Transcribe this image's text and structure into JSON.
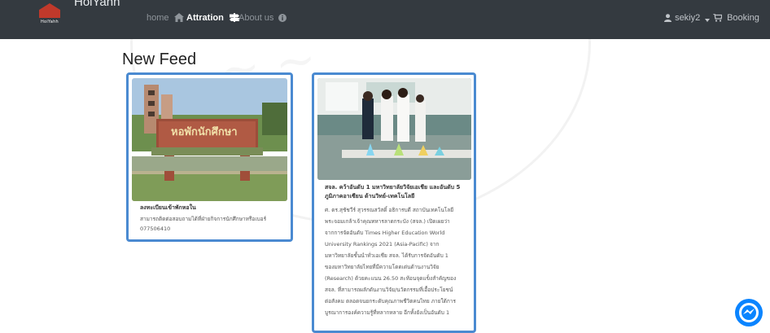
{
  "navbar": {
    "brand_title": "HoiYahh",
    "brand_sub": "HoiYahh",
    "home": "home",
    "attraction": "Attration",
    "about": "About us",
    "user": "sekiy2",
    "booking": "Booking"
  },
  "page": {
    "heading": "New Feed"
  },
  "posts": [
    {
      "title": "ลงทะเบียนเข้าพักหอใน",
      "body": [
        "สามารถติดต่อสอบถามได้ที่ฝ่ายกิจการนักศึกษาหรือเบอร์",
        "077506410"
      ],
      "image_caption": "หอพักนักศึกษา"
    },
    {
      "title": [
        "สจล. คว้าอันดับ 1 มหาวิทยาลัยวิจัยเอเชีย และอันดับ 5",
        "ภูมิภาคอาเซียน ด้านวิทย์-เทคโนโลยี"
      ],
      "body": [
        "ศ. ดร.สุชัชวีร์ สุวรรณสวัสดิ์ อธิการบดี สถาบันเทคโนโลยี",
        "พระจอมเกล้าเจ้าคุณทหารลาดกระบัง (สจล.) เปิดเผยว่า",
        "จากการจัดอันดับ Times Higher Education World",
        "University Rankings 2021 (Asia-Pacific) จาก",
        "มหาวิทยาลัยชั้นนำทั่วเอเชีย สจล. ได้รับการจัดอันดับ 1",
        "ของมหาวิทยาลัยไทยที่มีความโดดเด่นด้านงานวิจัย",
        "(Research) ด้วยคะแนน 26.50 สะท้อนจุดแข็งสำคัญของ",
        "สจล. ที่สามารถผลักดันงานวิจัย/นวัตกรรมที่เอื้อประโยชน์",
        "ต่อสังคม ตลอดจนยกระดับคุณภาพชีวิตคนไทย ภายใต้การ",
        "บูรณาการองค์ความรู้ที่หลากหลาย อีกทั้งยังเป็นอันดับ 1"
      ]
    }
  ],
  "colors": {
    "navbar": "#343a40",
    "card_border": "#4a8ad1",
    "messenger": "#0a84ff"
  }
}
